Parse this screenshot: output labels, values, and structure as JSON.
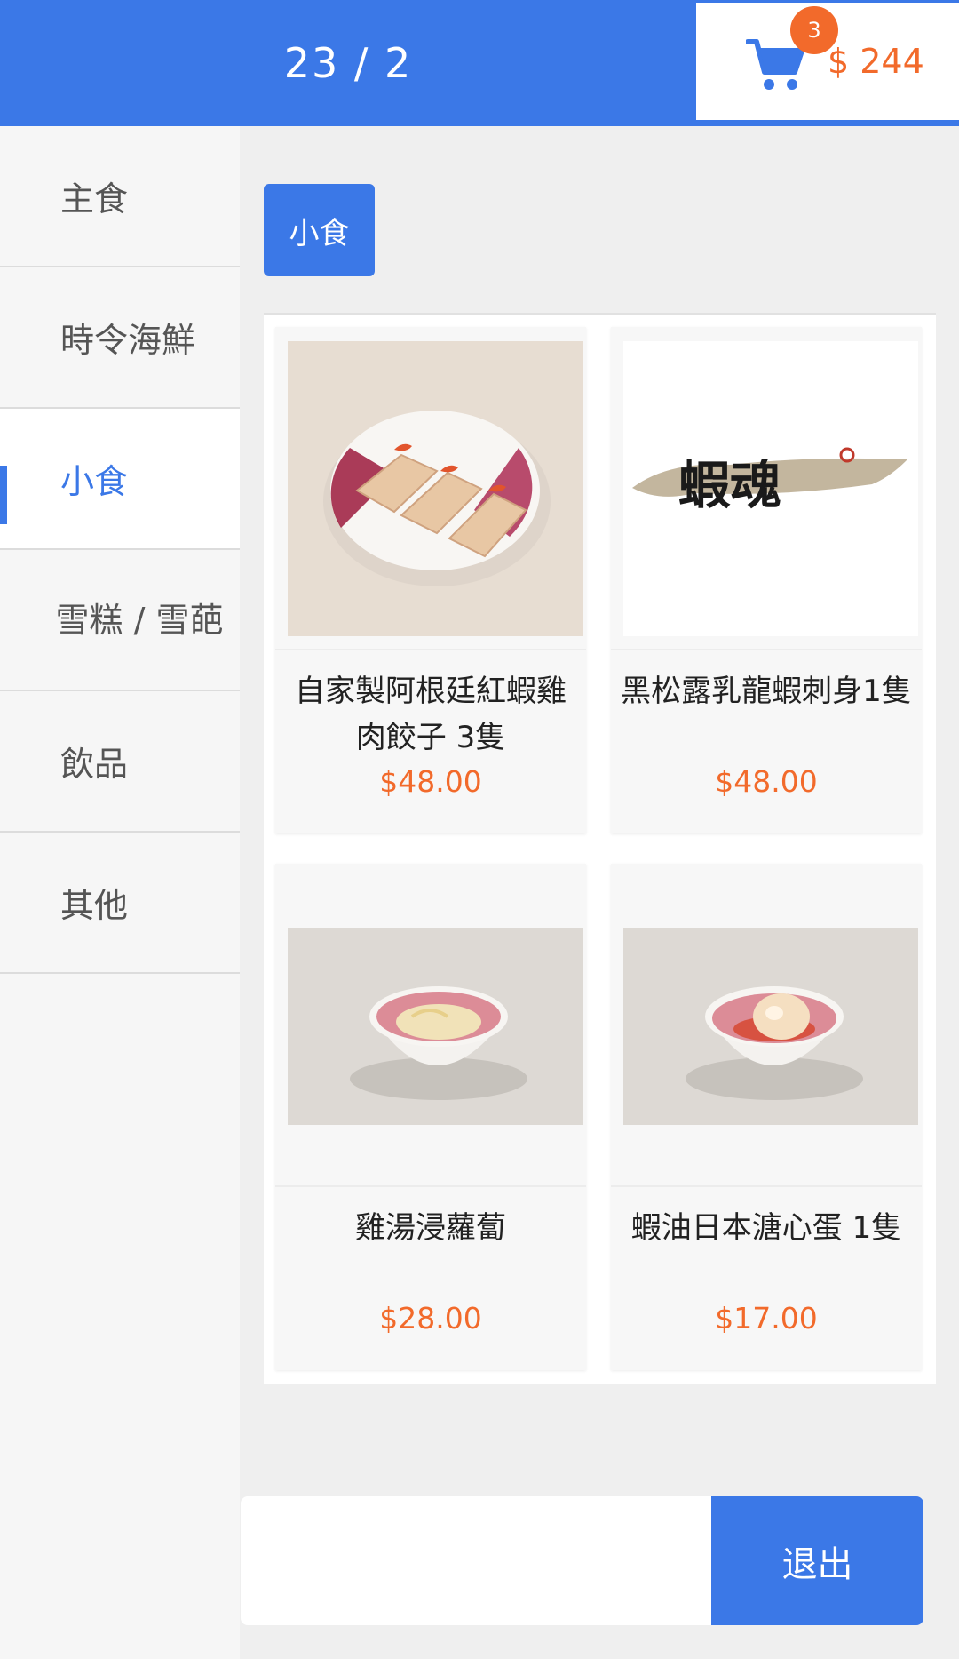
{
  "header": {
    "table_number": "23 / 2",
    "cart": {
      "icon": "shopping-cart-icon",
      "count": "3",
      "total": "$ 244",
      "total_color": "#f26a2b"
    },
    "accent_color": "#3b78e7"
  },
  "sidebar": {
    "items": [
      {
        "label": "主食"
      },
      {
        "label": "時令海鮮"
      },
      {
        "label": "小食",
        "active": true
      },
      {
        "label": "雪糕 / 雪葩"
      },
      {
        "label": "飲品"
      },
      {
        "label": "其他"
      }
    ]
  },
  "main": {
    "subtab": "小食",
    "products": [
      {
        "name": "自家製阿根廷紅蝦雞肉餃子 3隻",
        "price": "$48.00",
        "image": "shrimp-dumplings-photo"
      },
      {
        "name": "黑松露乳龍蝦刺身1隻",
        "price": "$48.00",
        "image": "restaurant-logo-image",
        "logo_text": "蝦魂"
      },
      {
        "name": "雞湯浸蘿蔔",
        "price": "$28.00",
        "image": "radish-soup-bowl-photo"
      },
      {
        "name": "蝦油日本溏心蛋 1隻",
        "price": "$17.00",
        "image": "soft-boiled-egg-bowl-photo"
      }
    ]
  },
  "footer": {
    "exit_label": "退出"
  }
}
